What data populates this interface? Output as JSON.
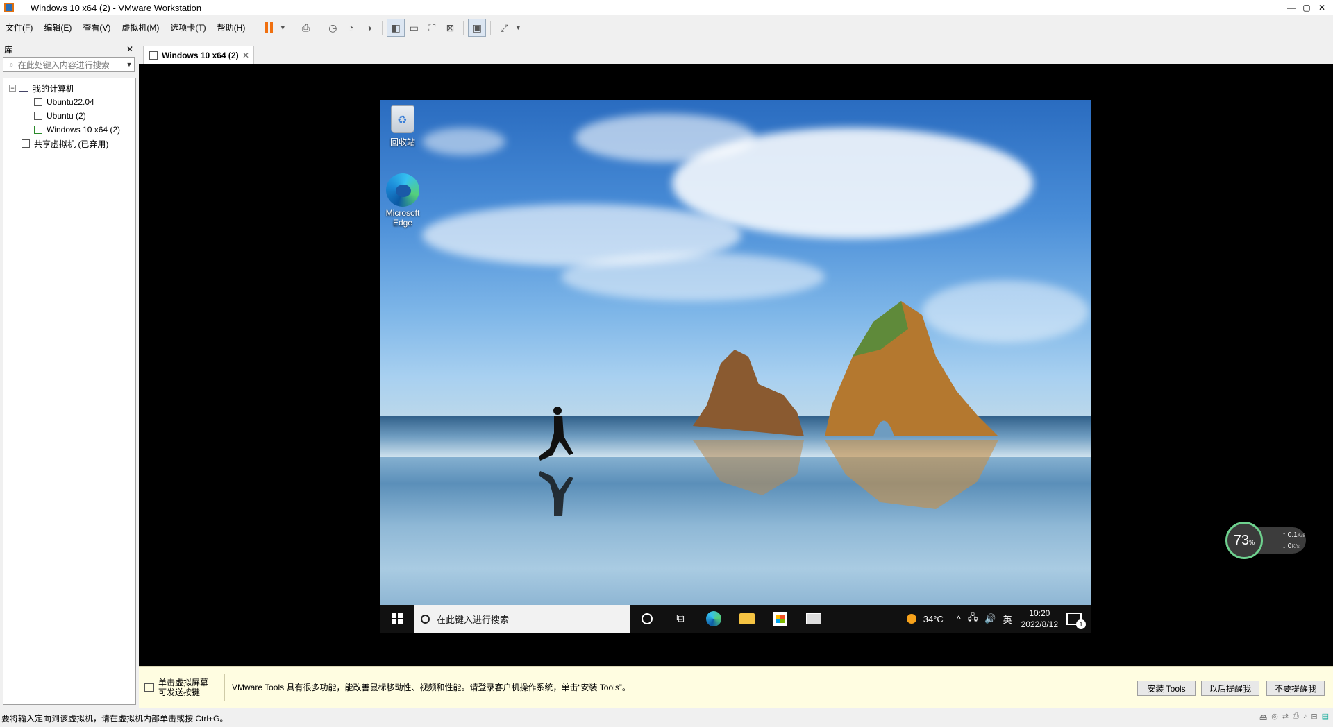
{
  "window": {
    "title": "Windows 10 x64 (2) - VMware Workstation",
    "controls": {
      "minimize": "—",
      "maximize": "▢",
      "close": "✕"
    }
  },
  "menu": [
    "文件(F)",
    "编辑(E)",
    "查看(V)",
    "虚拟机(M)",
    "选项卡(T)",
    "帮助(H)"
  ],
  "library": {
    "title": "库",
    "close": "✕",
    "search_placeholder": "在此处键入内容进行搜索",
    "tree": {
      "root": "我的计算机",
      "vms": [
        "Ubuntu22.04",
        "Ubuntu (2)",
        "Windows 10 x64 (2)"
      ],
      "shared": "共享虚拟机 (已弃用)"
    }
  },
  "tab": {
    "label": "Windows 10 x64 (2)",
    "close": "✕"
  },
  "guest": {
    "desktop_icons": [
      "回收站",
      "Microsoft Edge"
    ],
    "taskbar": {
      "search_placeholder": "在此键入进行搜索",
      "weather": "34°C",
      "ime": "英",
      "time": "10:20",
      "date": "2022/8/12",
      "notifications": "1"
    }
  },
  "gauge": {
    "percent": "73",
    "unit": "%",
    "upload": "0.1",
    "download": "0",
    "speed_unit": "K/s"
  },
  "hint": {
    "left_line1": "单击虚拟屏幕",
    "left_line2": "可发送按键",
    "message": "VMware Tools 具有很多功能，能改善鼠标移动性、视频和性能。请登录客户机操作系统，单击“安装 Tools”。",
    "buttons": [
      "安装 Tools",
      "以后提醒我",
      "不要提醒我"
    ]
  },
  "status": "要将输入定向到该虚拟机，请在虚拟机内部单击或按 Ctrl+G。"
}
